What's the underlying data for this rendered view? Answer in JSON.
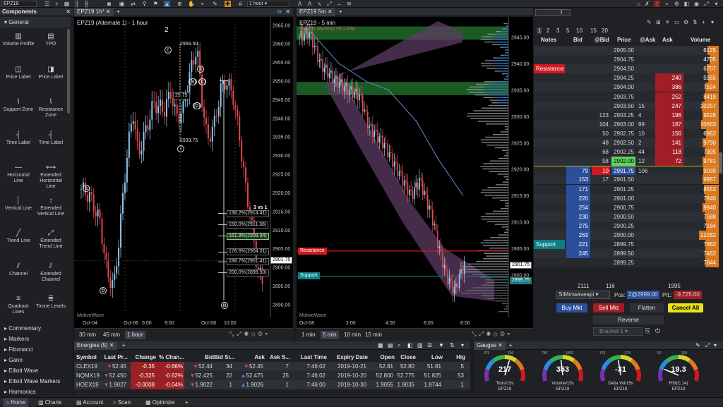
{
  "toolbar": {
    "symbol": "EPZ19",
    "timeframe": "1 hour",
    "search_symbol": "EPZ19"
  },
  "palette": {
    "title": "Components",
    "section": "General",
    "tools": [
      {
        "label": "Volume Profile",
        "icon": "volume-profile-icon"
      },
      {
        "label": "TPO",
        "icon": "tpo-icon"
      },
      {
        "label": "Price Label",
        "icon": "price-label-icon"
      },
      {
        "label": "Price Label",
        "icon": "price-label-alt-icon"
      },
      {
        "label": "Support Zone",
        "icon": "support-zone-icon"
      },
      {
        "label": "Resistance Zone",
        "icon": "resistance-zone-icon"
      },
      {
        "label": "Time Label",
        "icon": "time-label-icon"
      },
      {
        "label": "Time Label",
        "icon": "time-label-alt-icon"
      },
      {
        "label": "Horizontal Line",
        "icon": "horizontal-line-icon"
      },
      {
        "label": "Extended Horizontal Line",
        "icon": "extended-horizontal-line-icon"
      },
      {
        "label": "Vertical Line",
        "icon": "vertical-line-icon"
      },
      {
        "label": "Extended Vertical Line",
        "icon": "extended-vertical-line-icon"
      },
      {
        "label": "Trend Line",
        "icon": "trend-line-icon"
      },
      {
        "label": "Extended Trend Line",
        "icon": "extended-trend-line-icon"
      },
      {
        "label": "Channel",
        "icon": "channel-icon"
      },
      {
        "label": "Extended Channel",
        "icon": "extended-channel-icon"
      },
      {
        "label": "Quadrant Lines",
        "icon": "quadrant-lines-icon"
      },
      {
        "label": "Tirone Levels",
        "icon": "tirone-levels-icon"
      }
    ],
    "categories": [
      "Commentary",
      "Markers",
      "Fibonacci",
      "Gann",
      "Elliott Wave",
      "Elliott Wave Markers",
      "Harmonics"
    ]
  },
  "chart1": {
    "tab": "EPZ19 1h*",
    "title": "EPZ19 (Alternate 1) - 1 hour",
    "watermark": "MotiveWave",
    "price_ticks": [
      "2965.00",
      "2960.00",
      "2955.00",
      "2950.00",
      "2945.00",
      "2940.00",
      "2935.00",
      "2930.00",
      "2925.00",
      "2920.00",
      "2915.00",
      "2910.00",
      "2905.00",
      "2900.00",
      "2895.00",
      "2890.00"
    ],
    "time_ticks": [
      "Oct-04",
      "Oct-06",
      "0:00",
      "9:00",
      "Oct-08",
      "10:00"
    ],
    "timeframes": [
      "30 min",
      "45 min",
      "1 hour"
    ],
    "selected_timeframe": "1 hour",
    "current_price": "2901.75",
    "waves": [
      "2",
      "c",
      "ii",
      "(a)",
      "(c)",
      "(b)",
      "i",
      "a",
      "b",
      "iii"
    ],
    "annotations": {
      "high": "2959.50",
      "low": "2933.75",
      "mid": "25.75",
      "ratio_title": "3 vs 1"
    },
    "fib_levels": [
      "138.2%(2914.41)",
      "150.0%(2911.38)",
      "161.8%(2908.34)",
      "178.6%(2904.01)",
      "188.7%(2901.41)",
      "200.0%(2898.50)"
    ]
  },
  "chart2": {
    "tab": "EPZ19 5m",
    "title": "EPZ19 - 5 min",
    "legend": "VWAP(1 day,false) VP(1,Day)",
    "watermark": "MotiveWave",
    "price_ticks": [
      "2945.00",
      "2940.00",
      "2935.00",
      "2930.00",
      "2925.00",
      "2920.00",
      "2915.00",
      "2910.00",
      "2905.00",
      "2900.00"
    ],
    "time_ticks": [
      "Oct-08",
      "2:00",
      "4:00",
      "6:00",
      "8:00"
    ],
    "timeframes": [
      "1 min",
      "5 min",
      "10 min",
      "15 min"
    ],
    "selected_timeframe": "5 min",
    "resistance": "Resistance",
    "support": "Support",
    "current_price": "2901.75",
    "support_price": "2899.75"
  },
  "dom": {
    "qty": "1",
    "qty_options": [
      "1",
      "2",
      "3",
      "5",
      "10",
      "15",
      "20"
    ],
    "headers": [
      "Notes",
      "Bid",
      "@Bid",
      "Price",
      "@Ask",
      "Ask",
      "Volume"
    ],
    "rows": [
      {
        "note": "",
        "bid": "",
        "atbid": "",
        "price": "2905.00",
        "atask": "",
        "ask": "",
        "vol": "6125"
      },
      {
        "note": "",
        "bid": "",
        "atbid": "",
        "price": "2904.75",
        "atask": "",
        "ask": "",
        "vol": "4705"
      },
      {
        "note": "Resistance",
        "bid": "",
        "atbid": "",
        "price": "2904.50",
        "atask": "",
        "ask": "",
        "vol": "6707"
      },
      {
        "note": "",
        "bid": "",
        "atbid": "",
        "price": "2904.25",
        "atask": "",
        "ask": "240",
        "vol": "5555"
      },
      {
        "note": "",
        "bid": "",
        "atbid": "",
        "price": "2904.00",
        "atask": "",
        "ask": "386",
        "vol": "7524"
      },
      {
        "note": "",
        "bid": "",
        "atbid": "",
        "price": "2903.75",
        "atask": "",
        "ask": "252",
        "vol": "8419"
      },
      {
        "note": "",
        "bid": "",
        "atbid": "",
        "price": "2903.50",
        "atask": "15",
        "ask": "247",
        "vol": "10257"
      },
      {
        "note": "",
        "bid": "",
        "atbid": "123",
        "price": "2903.25",
        "atask": "4",
        "ask": "196",
        "vol": "9528"
      },
      {
        "note": "",
        "bid": "",
        "atbid": "104",
        "price": "2903.00",
        "atask": "99",
        "ask": "187",
        "vol": "10663"
      },
      {
        "note": "",
        "bid": "",
        "atbid": "50",
        "price": "2902.75",
        "atask": "10",
        "ask": "156",
        "vol": "6962"
      },
      {
        "note": "",
        "bid": "",
        "atbid": "48",
        "price": "2902.50",
        "atask": "2",
        "ask": "141",
        "vol": "9790"
      },
      {
        "note": "",
        "bid": "",
        "atbid": "68",
        "price": "2902.25",
        "atask": "44",
        "ask": "118",
        "vol": "7905"
      },
      {
        "note": "",
        "bid": "",
        "atbid": "58",
        "price": "2902.00",
        "atask": "12",
        "ask": "72",
        "vol": "9781"
      },
      {
        "note": "",
        "bid": "79",
        "atbid": "10",
        "price": "2901.75",
        "atask": "106",
        "ask": "",
        "vol": "9039"
      },
      {
        "note": "",
        "bid": "153",
        "atbid": "17",
        "price": "2901.50",
        "atask": "",
        "ask": "",
        "vol": "9957"
      },
      {
        "note": "",
        "bid": "171",
        "atbid": "",
        "price": "2901.25",
        "atask": "",
        "ask": "",
        "vol": "8553"
      },
      {
        "note": "",
        "bid": "220",
        "atbid": "",
        "price": "2901.00",
        "atask": "",
        "ask": "",
        "vol": "7840"
      },
      {
        "note": "",
        "bid": "254",
        "atbid": "",
        "price": "2900.75",
        "atask": "",
        "ask": "",
        "vol": "9840"
      },
      {
        "note": "",
        "bid": "230",
        "atbid": "",
        "price": "2900.50",
        "atask": "",
        "ask": "",
        "vol": "7588"
      },
      {
        "note": "",
        "bid": "275",
        "atbid": "",
        "price": "2900.25",
        "atask": "",
        "ask": "",
        "vol": "7184"
      },
      {
        "note": "",
        "bid": "263",
        "atbid": "",
        "price": "2900.00",
        "atask": "",
        "ask": "",
        "vol": "12282"
      },
      {
        "note": "Support",
        "bid": "221",
        "atbid": "",
        "price": "2899.75",
        "atask": "",
        "ask": "",
        "vol": "7862"
      },
      {
        "note": "",
        "bid": "245",
        "atbid": "",
        "price": "2899.50",
        "atask": "",
        "ask": "",
        "vol": "7462"
      },
      {
        "note": "",
        "bid": "",
        "atbid": "",
        "price": "2899.25",
        "atask": "",
        "ask": "",
        "vol": "7644"
      }
    ],
    "totals": {
      "bid": "2111",
      "atbid": "116",
      "vol": "1995"
    },
    "account": "SIMmwaveapi",
    "pos_label": "Pos:",
    "pos": "2@2999.00",
    "pl_label": "P/L:",
    "pl": "-9,725.00",
    "buy_mkt": "Buy Mkt",
    "sell_mkt": "Sell Mkt",
    "flatten": "Flatten",
    "cancel_all": "Cancel All",
    "reverse": "Reverse",
    "bracket": "Bracket 1"
  },
  "watchlist": {
    "tab": "Energies (5)",
    "headers": [
      "Symbol",
      "Last Pr...",
      "Change",
      "% Chan...",
      "Bid",
      "Bid Si...",
      "Ask",
      "Ask S...",
      "Last Time",
      "Expiry Date",
      "Open",
      "Close",
      "Low",
      "Hig"
    ],
    "rows": [
      {
        "symbol": "CLEX19",
        "last": "52.45",
        "change": "-0.35",
        "pct": "-0.66%",
        "bid": "52.44",
        "bidsize": "34",
        "ask": "52.45",
        "asksize": "7",
        "time": "7:46:02",
        "expiry": "2019-10-21",
        "open": "52.81",
        "close": "52.80",
        "low": "51.81",
        "high": "5"
      },
      {
        "symbol": "NQMX19",
        "last": "52.450",
        "change": "-0.325",
        "pct": "-0.62%",
        "bid": "52.425",
        "bidsize": "22",
        "ask": "52.475",
        "asksize": "25",
        "time": "7:46:02",
        "expiry": "2019-10-20",
        "open": "52.800",
        "close": "52.775",
        "low": "51.825",
        "high": "53"
      },
      {
        "symbol": "HOEX19",
        "last": "1.9027",
        "change": "-0.0008",
        "pct": "-0.04%",
        "bid": "1.9022",
        "bidsize": "1",
        "ask": "1.9026",
        "asksize": "1",
        "time": "7:46:00",
        "expiry": "2019-10-30",
        "open": "1.9055",
        "close": "1.9035",
        "low": "1.8744",
        "high": "1"
      }
    ]
  },
  "gauges": {
    "tab": "Gauges",
    "items": [
      {
        "value": "217",
        "label": "Ticks/15s",
        "symbol": "EPZ19",
        "scale": [
          "375",
          "750"
        ],
        "level": 0.58
      },
      {
        "value": "353",
        "label": "Volume/15s",
        "symbol": "EPZ19",
        "scale": [
          "750",
          "1500"
        ],
        "level": 0.47
      },
      {
        "value": "-31",
        "label": "Delta Vol/15s",
        "symbol": "EPZ19",
        "scale": [
          "375",
          "-375"
        ],
        "level": 0.46
      },
      {
        "value": "19.3",
        "label": "RSI(C,14)",
        "symbol": "EPZ19",
        "scale": [
          "50",
          "100"
        ],
        "level": 0.19
      }
    ]
  },
  "bottombar": {
    "tabs": [
      "Home",
      "Charts",
      "Account",
      "Scan",
      "Optimize"
    ],
    "add": "+"
  },
  "colors": {
    "bg": "#1b1d21",
    "bid_blue": "#2b4f9a",
    "ask_red": "#a01f26",
    "volume_orange": "#d9781f",
    "resistance": "#d0191f",
    "support": "#0c7f86",
    "candle_up": "#8fc4ea",
    "candle_down": "#e0474c"
  }
}
